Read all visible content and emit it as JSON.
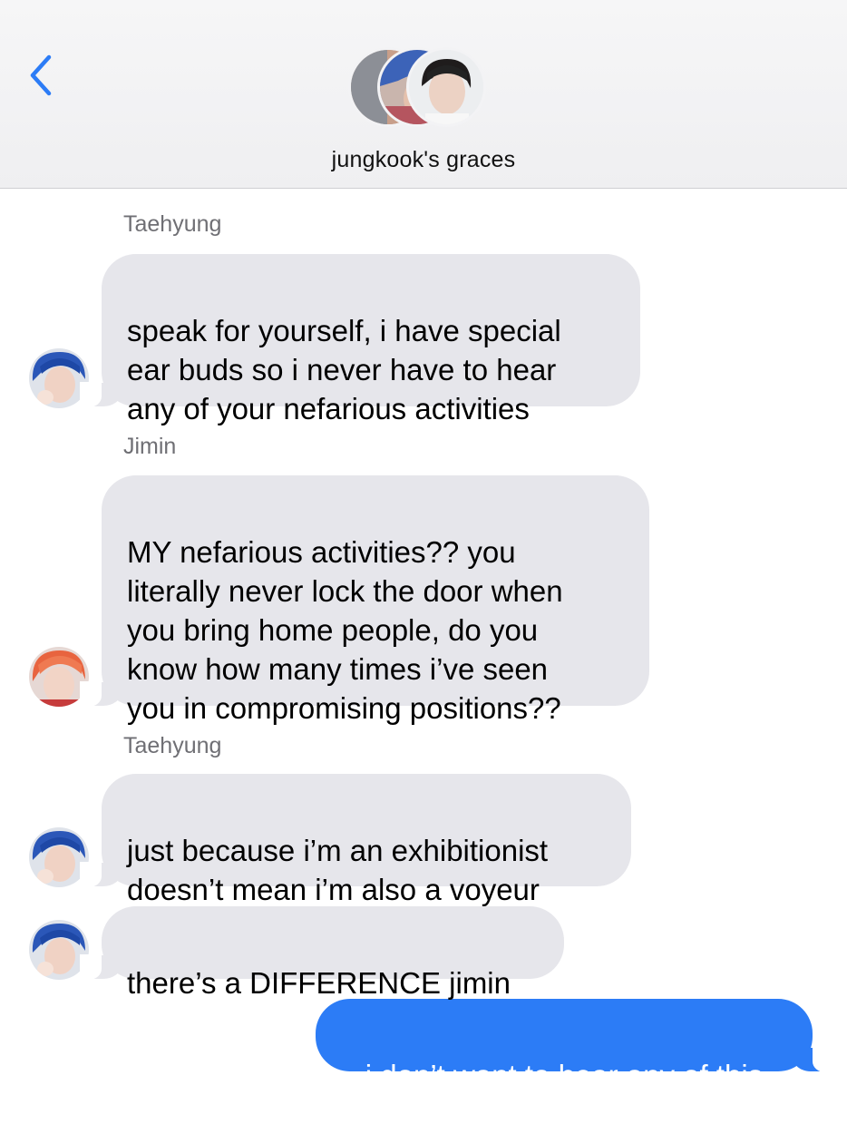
{
  "header": {
    "back_icon": "chevron-left-icon",
    "group_name": "jungkook's graces",
    "accent_color": "#2c7cf6"
  },
  "messages": [
    {
      "sender": "Taehyung",
      "text": "speak for yourself, i have special\near buds so i never have to hear\nany of your nefarious activities",
      "from_me": false,
      "avatar": "avatar-blue-hair"
    },
    {
      "sender": "Jimin",
      "text": "MY nefarious activities?? you\nliterally never lock the door when\nyou bring home people, do you\nknow how many times i’ve seen\nyou in compromising positions??",
      "from_me": false,
      "avatar": "avatar-orange-hair"
    },
    {
      "sender": "Taehyung",
      "text": "just because i’m an exhibitionist\ndoesn’t mean i’m also a voyeur",
      "from_me": false,
      "avatar": "avatar-blue-hair"
    },
    {
      "sender": "",
      "text": "there’s a DIFFERENCE jimin",
      "from_me": false,
      "avatar": "avatar-blue-hair"
    },
    {
      "sender": "",
      "text": "i don’t want to hear any of this",
      "from_me": true,
      "avatar": ""
    }
  ],
  "colors": {
    "incoming_bubble": "#e6e6eb",
    "outgoing_bubble": "#2c7cf6",
    "sender_label": "#6f6f74"
  }
}
